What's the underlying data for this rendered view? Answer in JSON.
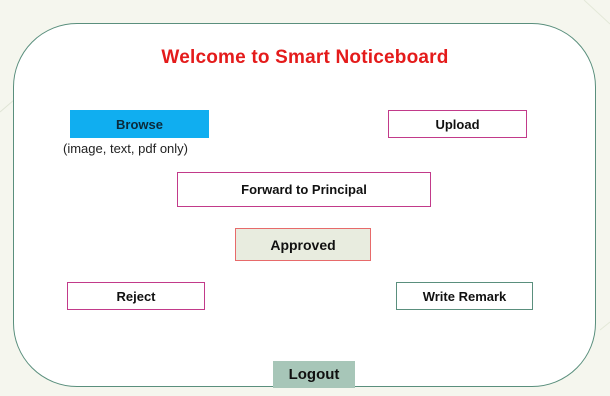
{
  "page": {
    "title": "Welcome to Smart Noticeboard"
  },
  "actions": {
    "browse_label": "Browse",
    "browse_hint": "(image, text, pdf only)",
    "upload_label": "Upload",
    "forward_label": "Forward to Principal",
    "approved_label": "Approved",
    "reject_label": "Reject",
    "remark_label": "Write Remark",
    "logout_label": "Logout"
  },
  "colors": {
    "title": "#e41b1b",
    "browse_fill": "#10aef0",
    "approved_fill": "#e8ecdf",
    "logout_fill": "#a7c6b8",
    "magenta_border": "#c23a8a",
    "teal_border": "#5a8f7d"
  }
}
